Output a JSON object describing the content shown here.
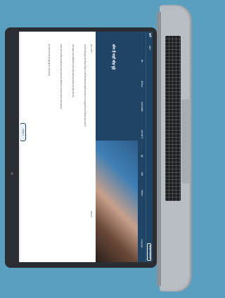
{
  "site": {
    "logo": "मार्ग",
    "search_label": "खोजें",
    "top_button": "कार्यक्षेत्र में संपर्क करें"
  },
  "nav": {
    "items": [
      "होम",
      "डोनेशन्स",
      "हमारे कार्यक्षेत्र",
      "हमारे बारे में",
      "जुड़ें",
      "ब्लॉग",
      "नवीनतम"
    ],
    "language": "Language"
  },
  "hero": {
    "title": "लोग हैं जहाँ थोड़ मुद्दे"
  },
  "breadcrumb": "होम > ब्लॉग >",
  "share_label": "साझा करें",
  "paragraphs": [
    "यह बच्चों की सुरक्षा और शिक्षा के विषय में लोगों की जागरूकता बढ़ाने का प्रयास है। हम समुदायों के साथ मिलकर काम करते हैं।",
    "लोग अक्सर अपने अधिकारों के बारे में नहीं जानते और सेवाओं तक पहुँच नहीं पाते।",
    "हमारा उद्देश्य स्थानीय संसाधनों को सशक्त बनाना और परिवारों को आवश्यक सहायता प्रदान करना है।",
    "इस लेख में हम ऐसे ही कुछ मुद्दों पर चर्चा करते हैं।"
  ],
  "feedback_button": "प्रतिक्रिया दें"
}
